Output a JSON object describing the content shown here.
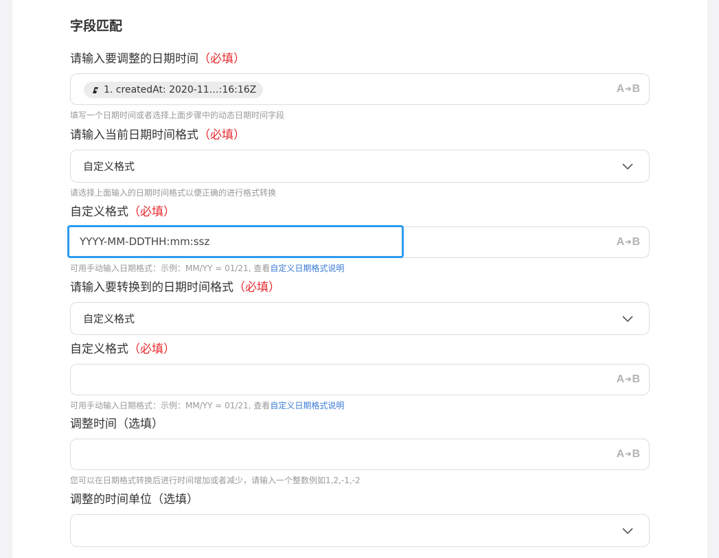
{
  "section": {
    "title": "字段匹配"
  },
  "required_mark": "（必填）",
  "ab_badge": {
    "a": "A",
    "arrow": "➔",
    "b": "B"
  },
  "fields": {
    "datetime": {
      "label": "请输入要调整的日期时间",
      "chip_text": "1. createdAt: 2020-11…:16:16Z",
      "chip_icon": "app-logo-icon",
      "hint": "填写一个日期时间或者选择上面步骤中的动态日期时间字段"
    },
    "current_format": {
      "label": "请输入当前日期时间格式",
      "value": "自定义格式",
      "hint": "请选择上面输入的日期时间格式以便正确的进行格式转换"
    },
    "custom_format_1": {
      "label": "自定义格式",
      "value": "YYYY-MM-DDTHH:mm:ssz",
      "hint_prefix": "可用手动输入日期格式：示例：MM/YY = 01/21, 查看",
      "hint_link": "自定义日期格式说明"
    },
    "target_format": {
      "label": "请输入要转换到的日期时间格式",
      "value": "自定义格式"
    },
    "custom_format_2": {
      "label": "自定义格式",
      "value": "",
      "hint_prefix": "可用手动输入日期格式：示例：MM/YY = 01/21, 查看",
      "hint_link": "自定义日期格式说明"
    },
    "adjust_time": {
      "label": "调整时间（选填）",
      "value": "",
      "hint": "您可以在日期格式转换后进行时间增加或者减少，请输入一个整数例如1,2,-1,-2"
    },
    "adjust_unit": {
      "label": "调整的时间单位（选填）",
      "value": ""
    }
  },
  "colors": {
    "required": "#e8262b",
    "link": "#3a7bd5",
    "focus_border": "#2b9cf0"
  }
}
